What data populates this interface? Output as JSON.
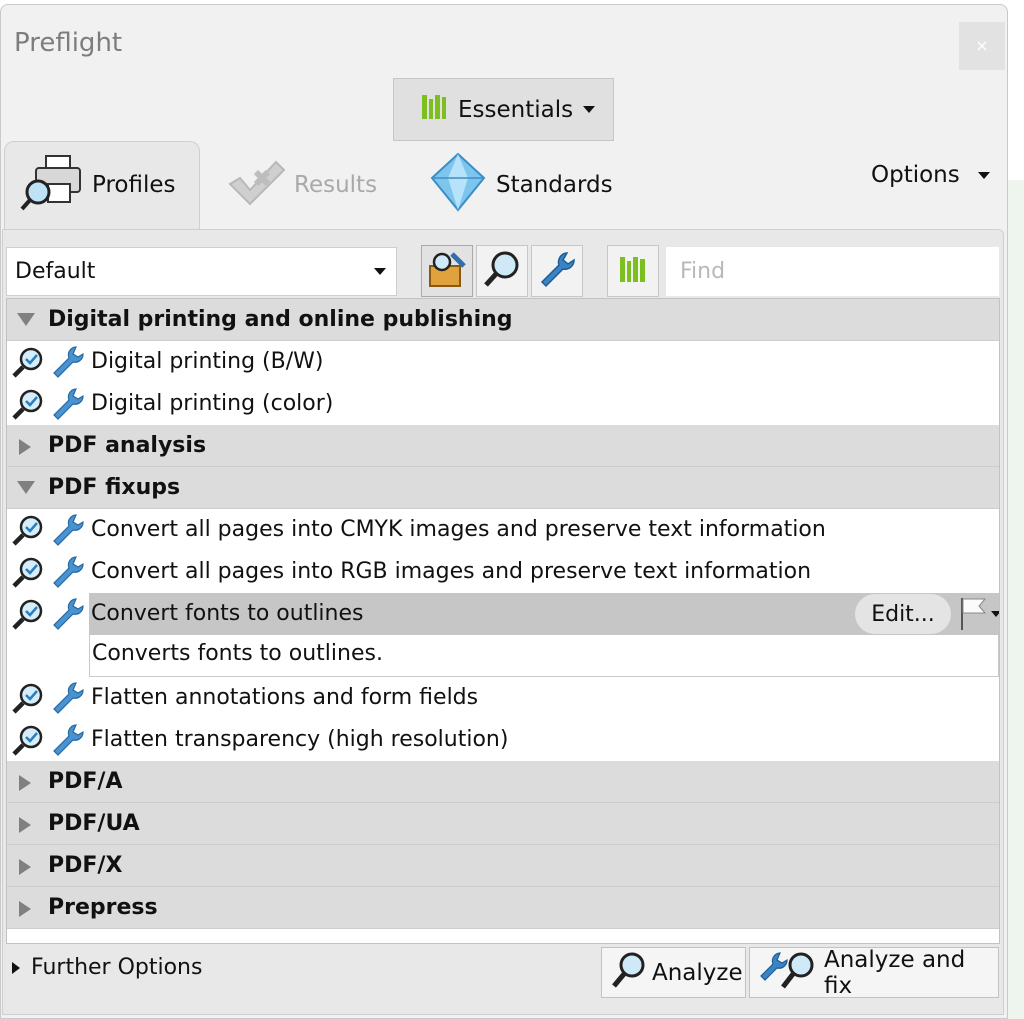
{
  "window": {
    "title": "Preflight",
    "close_label": "×"
  },
  "essentials": {
    "label": "Essentials",
    "icon": "library-bars-icon",
    "accent": "#7dbf1e"
  },
  "tabs": [
    {
      "label": "Profiles",
      "icon": "printer-magnifier-icon",
      "active": true
    },
    {
      "label": "Results",
      "icon": "results-checkmark-icon",
      "active": false
    },
    {
      "label": "Standards",
      "icon": "diamond-icon",
      "active": false
    }
  ],
  "options": {
    "label": "Options"
  },
  "toolbar": {
    "profile_select": "Default",
    "find_placeholder": "Find",
    "buttons": [
      "all-profiles-icon",
      "check-icon",
      "fixup-wrench-icon",
      "library-bars-icon"
    ]
  },
  "tree": {
    "groups": [
      {
        "label": "Digital printing and online publishing",
        "expanded": true,
        "items": [
          "Digital printing (B/W)",
          "Digital printing (color)"
        ]
      },
      {
        "label": "PDF analysis",
        "expanded": false,
        "items": []
      },
      {
        "label": "PDF fixups",
        "expanded": true,
        "items": [
          "Convert all pages into CMYK images and preserve text information",
          "Convert all pages into RGB images and preserve text information",
          "Convert fonts to outlines",
          "Flatten annotations and form fields",
          "Flatten transparency (high resolution)"
        ]
      },
      {
        "label": "PDF/A",
        "expanded": false,
        "items": []
      },
      {
        "label": "PDF/UA",
        "expanded": false,
        "items": []
      },
      {
        "label": "PDF/X",
        "expanded": false,
        "items": []
      },
      {
        "label": "Prepress",
        "expanded": false,
        "items": []
      }
    ],
    "selected": {
      "label": "Convert fonts to outlines",
      "description": "Converts fonts to outlines.",
      "edit_label": "Edit..."
    }
  },
  "footer": {
    "further_options": "Further Options",
    "analyze_label": "Analyze",
    "analyze_fix_label": "Analyze and fix"
  }
}
